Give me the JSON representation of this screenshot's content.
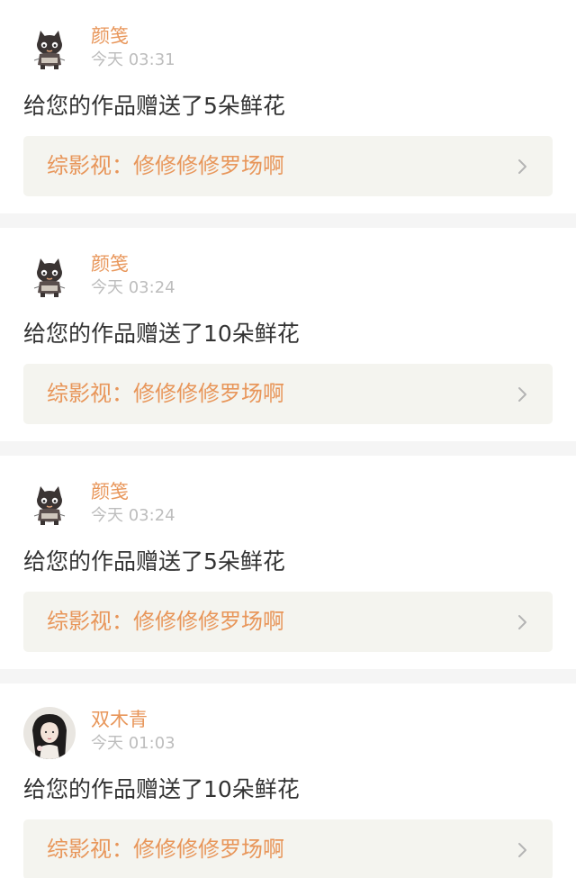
{
  "feed": {
    "items": [
      {
        "avatar": "cat-avatar",
        "name": "颜笺",
        "time": "今天 03:31",
        "message": "给您的作品赠送了5朵鲜花",
        "work_title": "综影视：修修修修罗场啊"
      },
      {
        "avatar": "cat-avatar",
        "name": "颜笺",
        "time": "今天 03:24",
        "message": "给您的作品赠送了10朵鲜花",
        "work_title": "综影视：修修修修罗场啊"
      },
      {
        "avatar": "cat-avatar",
        "name": "颜笺",
        "time": "今天 03:24",
        "message": "给您的作品赠送了5朵鲜花",
        "work_title": "综影视：修修修修罗场啊"
      },
      {
        "avatar": "girl-portrait-avatar",
        "name": "双木青",
        "time": "今天 01:03",
        "message": "给您的作品赠送了10朵鲜花",
        "work_title": "综影视：修修修修罗场啊"
      }
    ]
  },
  "icons": {
    "chevron": "chevron-right-icon"
  },
  "colors": {
    "accent": "#e8965a",
    "time_text": "#bdbdbd",
    "message_text": "#333333",
    "link_bg": "#f4f4ef",
    "separator": "#f5f5f5"
  }
}
